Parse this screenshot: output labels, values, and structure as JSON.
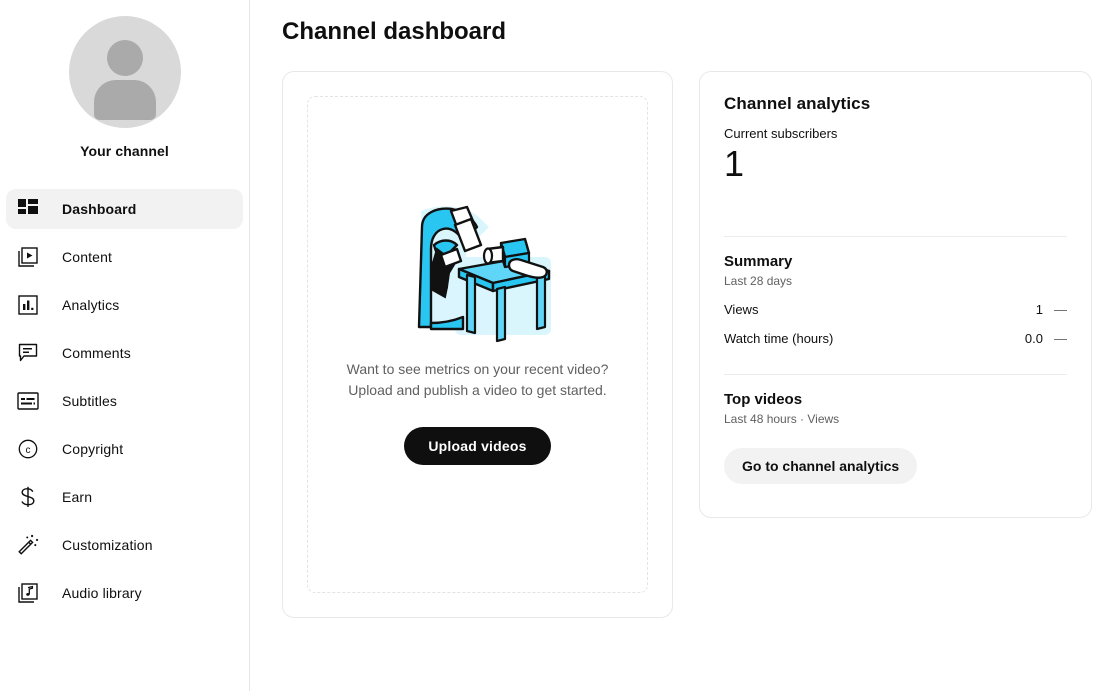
{
  "sidebar": {
    "channel": {
      "avatar_icon": "default-user-avatar",
      "name": "Your channel"
    },
    "items": [
      {
        "label": "Dashboard",
        "icon": "dashboard-grid-icon",
        "active": true
      },
      {
        "label": "Content",
        "icon": "video-play-icon",
        "active": false
      },
      {
        "label": "Analytics",
        "icon": "bar-chart-icon",
        "active": false
      },
      {
        "label": "Comments",
        "icon": "comment-bubble-icon",
        "active": false
      },
      {
        "label": "Subtitles",
        "icon": "subtitles-icon",
        "active": false
      },
      {
        "label": "Copyright",
        "icon": "copyright-icon",
        "active": false
      },
      {
        "label": "Earn",
        "icon": "dollar-sign-icon",
        "active": false
      },
      {
        "label": "Customization",
        "icon": "magic-wand-icon",
        "active": false
      },
      {
        "label": "Audio library",
        "icon": "music-note-icon",
        "active": false
      }
    ]
  },
  "main": {
    "page_title": "Channel dashboard",
    "upload_card": {
      "illustration": "person-filming-with-camera-illustration",
      "prompt_line1": "Want to see metrics on your recent video?",
      "prompt_line2": "Upload and publish a video to get started.",
      "button_label": "Upload videos"
    },
    "analytics_card": {
      "title": "Channel analytics",
      "subscribers_label": "Current subscribers",
      "subscribers_value": "1",
      "summary": {
        "title": "Summary",
        "subtitle": "Last 28 days",
        "metrics": [
          {
            "name": "Views",
            "value": "1",
            "trend": "—"
          },
          {
            "name": "Watch time (hours)",
            "value": "0.0",
            "trend": "—"
          }
        ]
      },
      "top_videos": {
        "title": "Top videos",
        "subtitle": "Last 48 hours · Views"
      },
      "link_label": "Go to channel analytics"
    }
  },
  "colors": {
    "accent_illustration": "#29c6f2",
    "illustration_light": "#aeeafb",
    "text_primary": "#0f0f0f",
    "text_secondary": "#606060",
    "active_nav_bg": "#f2f2f2",
    "button_primary_bg": "#0f0f0f"
  }
}
